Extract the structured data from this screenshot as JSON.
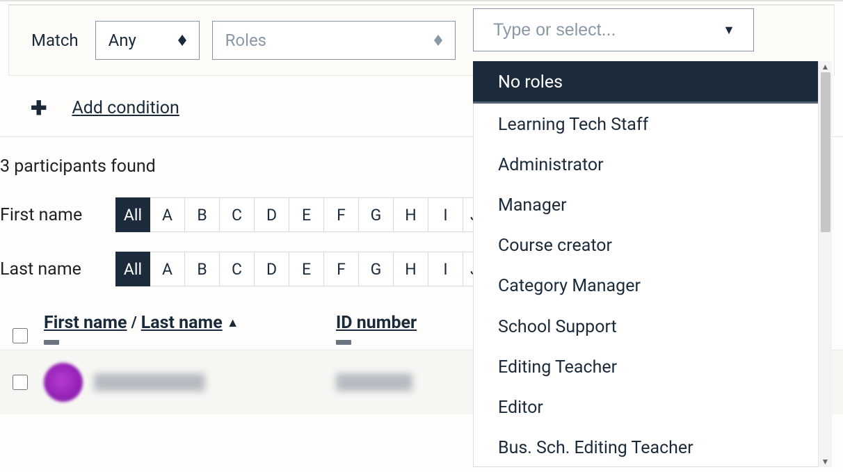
{
  "filter": {
    "match_label": "Match",
    "match_value": "Any",
    "field_value": "Roles",
    "role_placeholder": "Type or select..."
  },
  "role_dropdown": {
    "options": [
      "No roles",
      "Learning Tech Staff",
      "Administrator",
      "Manager",
      "Course creator",
      "Category Manager",
      "School Support",
      "Editing Teacher",
      "Editor",
      "Bus. Sch. Editing Teacher"
    ],
    "selected_index": 0
  },
  "add_condition_label": "Add condition",
  "participants_found": "3 participants found",
  "alpha": {
    "first_label": "First name",
    "last_label": "Last name",
    "all_label": "All",
    "letters": [
      "A",
      "B",
      "C",
      "D",
      "E",
      "F",
      "G",
      "H",
      "I"
    ],
    "cutoff": "J"
  },
  "table": {
    "col_first": "First name",
    "col_last": "Last name",
    "col_id": "ID number"
  }
}
